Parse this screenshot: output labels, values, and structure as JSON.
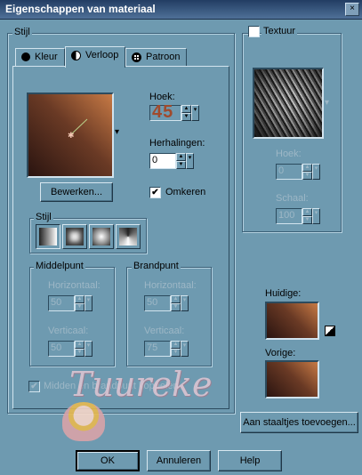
{
  "window": {
    "title": "Eigenschappen van materiaal",
    "close_glyph": "×"
  },
  "stijl_group": {
    "label": "Stijl"
  },
  "tabs": [
    {
      "label": "Kleur",
      "icon": "filled-circle-icon",
      "active": false
    },
    {
      "label": "Verloop",
      "icon": "half-circle-gradient-icon",
      "active": true
    },
    {
      "label": "Patroon",
      "icon": "pattern-grid-icon",
      "active": false
    }
  ],
  "gradient": {
    "colors": {
      "start": "#2a1410",
      "mid": "#6a3a25",
      "end": "#c77a45"
    },
    "hoek_label": "Hoek:",
    "hoek_value": "45",
    "herhalingen_label": "Herhalingen:",
    "herhalingen_value": "0",
    "bewerken_label": "Bewerken...",
    "omkeren_label": "Omkeren",
    "omkeren_checked": true,
    "stijl_label": "Stijl",
    "styles": [
      "linear",
      "rectangular",
      "sunburst",
      "radial"
    ]
  },
  "middelpunt": {
    "label": "Middelpunt",
    "horizontaal_label": "Horizontaal:",
    "horizontaal_value": "50",
    "verticaal_label": "Verticaal:",
    "verticaal_value": "50"
  },
  "brandpunt": {
    "label": "Brandpunt",
    "horizontaal_label": "Horizontaal:",
    "horizontaal_value": "50",
    "verticaal_label": "Verticaal:",
    "verticaal_value": "75"
  },
  "koppelen": {
    "label": "Midden en brandpunt koppelen",
    "checked": true
  },
  "watermark": {
    "text": "Tuureke"
  },
  "textuur": {
    "label": "Textuur",
    "checked": false,
    "hoek_label": "Hoek:",
    "hoek_value": "0",
    "schaal_label": "Schaal:",
    "schaal_value": "100"
  },
  "huidige": {
    "label": "Huidige:"
  },
  "vorige": {
    "label": "Vorige:"
  },
  "buttons": {
    "aan_staaltjes": "Aan staaltjes toevoegen...",
    "ok": "OK",
    "annuleren": "Annuleren",
    "help": "Help"
  },
  "spin_up": "▲",
  "spin_down": "▼",
  "dropdown": "▾"
}
